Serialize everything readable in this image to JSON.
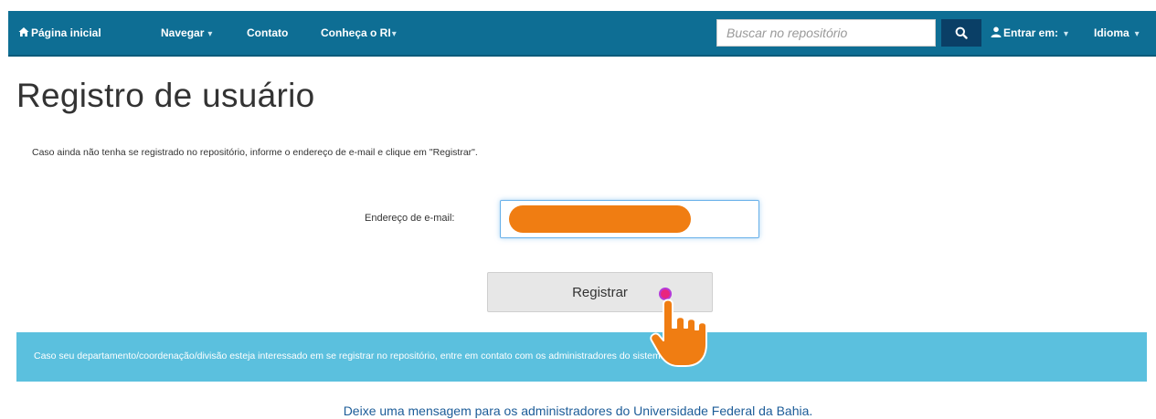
{
  "navbar": {
    "home_label": "Página inicial",
    "browse_label": "Navegar",
    "contact_label": "Contato",
    "about_label": "Conheça o RI",
    "search_placeholder": "Buscar no repositório",
    "login_label": "Entrar em:",
    "language_label": "Idioma",
    "icons": {
      "home": "home-icon",
      "search": "search-icon",
      "user": "user-icon",
      "caret": "caret-down-icon"
    }
  },
  "page": {
    "title": "Registro de usuário",
    "intro": "Caso ainda não tenha se registrado no repositório, informe o endereço de e-mail e clique em \"Registrar\".",
    "email_label": "Endereço de e-mail:",
    "email_value": "",
    "register_label": "Registrar"
  },
  "alert": {
    "text": "Caso seu departamento/coordenação/divisão esteja interessado em se registrar no repositório, entre em contato com os administradores do sistema"
  },
  "footer": {
    "feedback_link": "Deixe uma mensagem para os administradores do Universidade Federal da Bahia."
  },
  "colors": {
    "navbar": "#0e6e94",
    "search_button": "#0a3f66",
    "alert_bg": "#5bc0de",
    "redaction": "#f07d12",
    "link": "#1c5c98"
  }
}
